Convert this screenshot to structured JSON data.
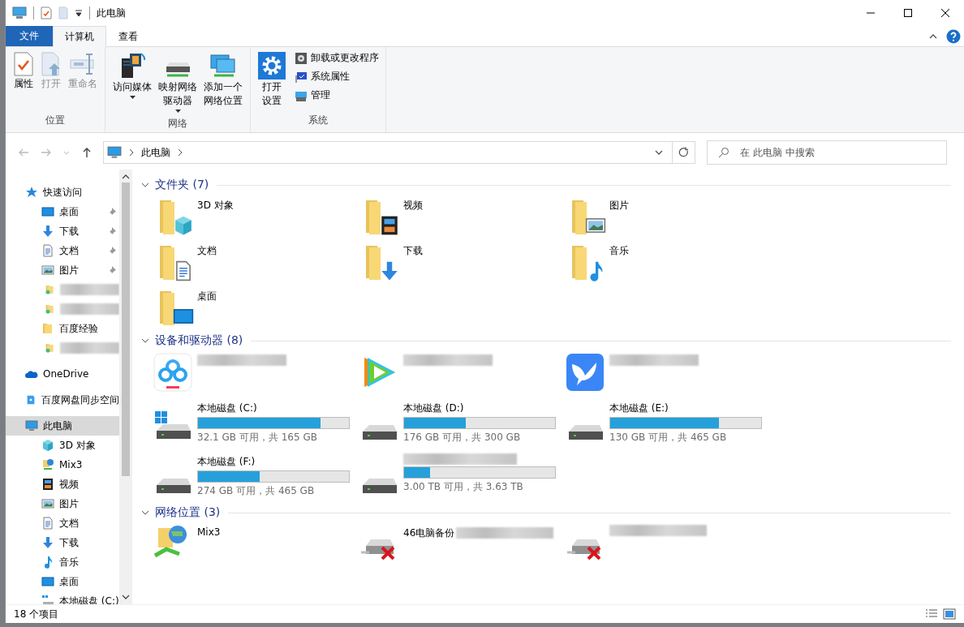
{
  "window": {
    "title": "此电脑"
  },
  "ribbon_tabs": [
    {
      "label": "文件",
      "kind": "file",
      "selected": false
    },
    {
      "label": "计算机",
      "kind": "tab",
      "selected": true
    },
    {
      "label": "查看",
      "kind": "tab",
      "selected": false
    }
  ],
  "ribbon_groups": [
    {
      "label": "位置",
      "buttons": [
        {
          "lines": [
            "属性"
          ],
          "disabled": false,
          "dropdown": false
        },
        {
          "lines": [
            "打开"
          ],
          "disabled": true,
          "dropdown": false
        },
        {
          "lines": [
            "重命名"
          ],
          "disabled": true,
          "dropdown": false
        }
      ]
    },
    {
      "label": "网络",
      "buttons": [
        {
          "lines": [
            "访问媒体"
          ],
          "disabled": false,
          "dropdown": true
        },
        {
          "lines": [
            "映射网络",
            "驱动器"
          ],
          "disabled": false,
          "dropdown": true
        },
        {
          "lines": [
            "添加一个",
            "网络位置"
          ],
          "disabled": false,
          "dropdown": false
        }
      ]
    },
    {
      "label": "系统",
      "buttons": [
        {
          "lines": [
            "打开",
            "设置"
          ],
          "disabled": false,
          "dropdown": false
        }
      ],
      "small_buttons": [
        "卸载或更改程序",
        "系统属性",
        "管理"
      ]
    }
  ],
  "address": {
    "breadcrumb": [
      "此电脑"
    ],
    "search_placeholder": "在 此电脑 中搜索"
  },
  "sidebar": [
    {
      "label": "快速访问",
      "selected": false,
      "children": [
        {
          "label": "桌面",
          "pinned": true,
          "selected": false
        },
        {
          "label": "下载",
          "pinned": true,
          "selected": false
        },
        {
          "label": "文档",
          "pinned": true,
          "selected": false
        },
        {
          "label": "图片",
          "pinned": true,
          "selected": false
        },
        {
          "obscured": true
        },
        {
          "obscured": true
        },
        {
          "label": "百度经验",
          "pinned": false,
          "selected": false
        },
        {
          "obscured": true
        }
      ]
    },
    {
      "label": "OneDrive",
      "selected": false
    },
    {
      "label": "百度网盘同步空间",
      "selected": false
    },
    {
      "label": "此电脑",
      "selected": true,
      "children": [
        {
          "label": "3D 对象",
          "selected": false
        },
        {
          "label": "Mix3",
          "selected": false
        },
        {
          "label": "视频",
          "selected": false
        },
        {
          "label": "图片",
          "selected": false
        },
        {
          "label": "文档",
          "selected": false
        },
        {
          "label": "下载",
          "selected": false
        },
        {
          "label": "音乐",
          "selected": false
        },
        {
          "label": "桌面",
          "selected": false
        },
        {
          "label": "本地磁盘 (C:)",
          "selected": false
        }
      ]
    }
  ],
  "sections": [
    {
      "title": "文件夹 (7)",
      "expanded": true,
      "items": [
        {
          "kind": "folder",
          "label": "3D 对象"
        },
        {
          "kind": "folder",
          "label": "视频"
        },
        {
          "kind": "folder",
          "label": "图片"
        },
        {
          "kind": "folder",
          "label": "文档"
        },
        {
          "kind": "folder",
          "label": "下载"
        },
        {
          "kind": "folder",
          "label": "音乐"
        },
        {
          "kind": "folder",
          "label": "桌面"
        }
      ]
    },
    {
      "title": "设备和驱动器 (8)",
      "expanded": true,
      "items": [
        {
          "kind": "app",
          "obscured": true
        },
        {
          "kind": "app",
          "obscured": true
        },
        {
          "kind": "app",
          "obscured": true
        },
        {
          "kind": "system_drive",
          "label": "本地磁盘 (C:)",
          "level": 0.81,
          "info": "32.1 GB 可用，共 165 GB"
        },
        {
          "kind": "drive",
          "label": "本地磁盘 (D:)",
          "level": 0.41,
          "info": "176 GB 可用，共 300 GB"
        },
        {
          "kind": "drive",
          "label": "本地磁盘 (E:)",
          "level": 0.72,
          "info": "130 GB 可用，共 465 GB"
        },
        {
          "kind": "drive",
          "label": "本地磁盘 (F:)",
          "level": 0.41,
          "info": "274 GB 可用，共 465 GB"
        },
        {
          "kind": "drive",
          "obscured": true,
          "level": 0.17,
          "info": "3.00 TB 可用，共 3.63 TB"
        }
      ]
    },
    {
      "title": "网络位置 (3)",
      "expanded": true,
      "items": [
        {
          "kind": "share",
          "label": "Mix3"
        },
        {
          "kind": "disconnected",
          "label": "46电脑备份",
          "obscured": true
        },
        {
          "kind": "disconnected",
          "obscured": true
        }
      ]
    }
  ],
  "status_bar": {
    "count": "18 个项目"
  }
}
